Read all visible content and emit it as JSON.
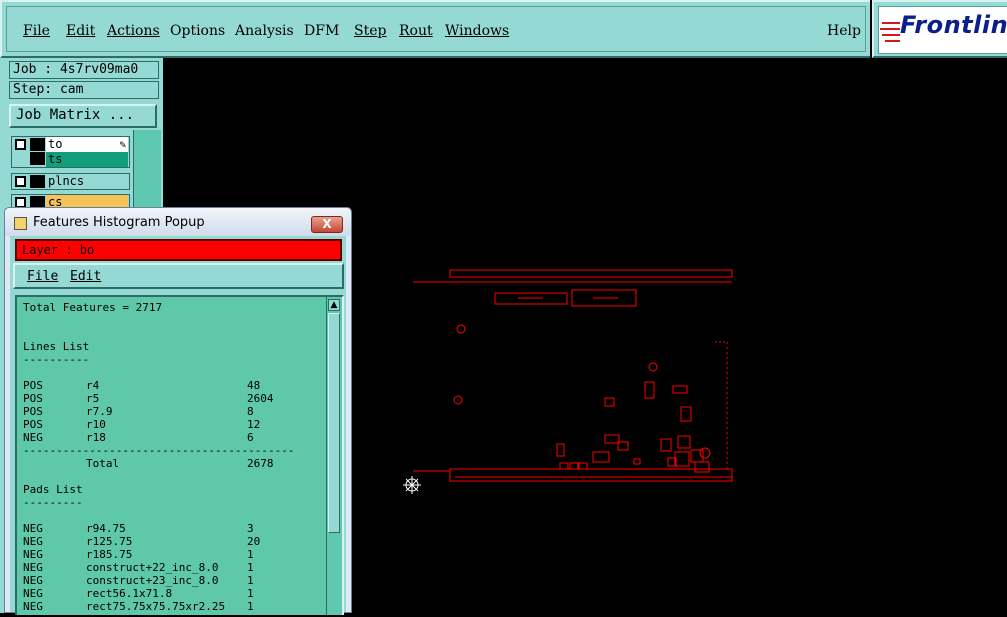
{
  "menubar": {
    "items": [
      {
        "label": "File",
        "underline": true
      },
      {
        "label": "Edit",
        "underline": true
      },
      {
        "label": "Actions",
        "underline": true
      },
      {
        "label": "Options",
        "underline": false
      },
      {
        "label": "Analysis",
        "underline": false
      },
      {
        "label": "DFM",
        "underline": false
      },
      {
        "label": "Step",
        "underline": true
      },
      {
        "label": "Rout",
        "underline": true
      },
      {
        "label": "Windows",
        "underline": true
      }
    ],
    "help_label": "Help"
  },
  "logo": {
    "text": "Frontline"
  },
  "left_panel": {
    "job": "Job : 4s7rv09ma0",
    "step": "Step: cam",
    "job_matrix_label": "Job Matrix ..."
  },
  "layers": [
    {
      "name": "to",
      "color": "#ffffff",
      "selected": false,
      "editing": true
    },
    {
      "name": "ts",
      "color": "#119e7a",
      "selected": false,
      "editing": false
    },
    {
      "name": "plncs",
      "color": "#94d9d4",
      "selected": false,
      "editing": false
    },
    {
      "name": "cs",
      "color": "#f5c35a",
      "selected": false,
      "editing": false
    }
  ],
  "popup": {
    "title": "Features Histogram Popup",
    "close_label": "X",
    "layer_label": "Layer :  bo",
    "menu": {
      "file": "File",
      "edit": "Edit"
    },
    "total_features": "Total Features = 2717",
    "lines_heading": "Lines List",
    "lines_underline": "----------",
    "lines": [
      {
        "polarity": "POS",
        "symbol": "r4",
        "count": "48"
      },
      {
        "polarity": "POS",
        "symbol": "r5",
        "count": "2604"
      },
      {
        "polarity": "POS",
        "symbol": "r7.9",
        "count": "8"
      },
      {
        "polarity": "POS",
        "symbol": "r10",
        "count": "12"
      },
      {
        "polarity": "NEG",
        "symbol": "r18",
        "count": "6"
      }
    ],
    "separator": "-----------------------------------------",
    "total_label": "Total",
    "total_value": "2678",
    "pads_heading": "Pads List",
    "pads_underline": "---------",
    "pads": [
      {
        "polarity": "NEG",
        "symbol": "r94.75",
        "count": "3"
      },
      {
        "polarity": "NEG",
        "symbol": "r125.75",
        "count": "20"
      },
      {
        "polarity": "NEG",
        "symbol": "r185.75",
        "count": "1"
      },
      {
        "polarity": "NEG",
        "symbol": "construct+22_inc_8.0",
        "count": "1"
      },
      {
        "polarity": "NEG",
        "symbol": "construct+23_inc_8.0",
        "count": "1"
      },
      {
        "polarity": "NEG",
        "symbol": "rect56.1x71.8",
        "count": "1"
      },
      {
        "polarity": "NEG",
        "symbol": "rect75.75x75.75xr2.25",
        "count": "1"
      }
    ]
  },
  "colors": {
    "teal_panel": "#94d9d4",
    "list_bg": "#5ec8a8",
    "feature_red": "#ff0000",
    "canvas_bg": "#000000"
  }
}
